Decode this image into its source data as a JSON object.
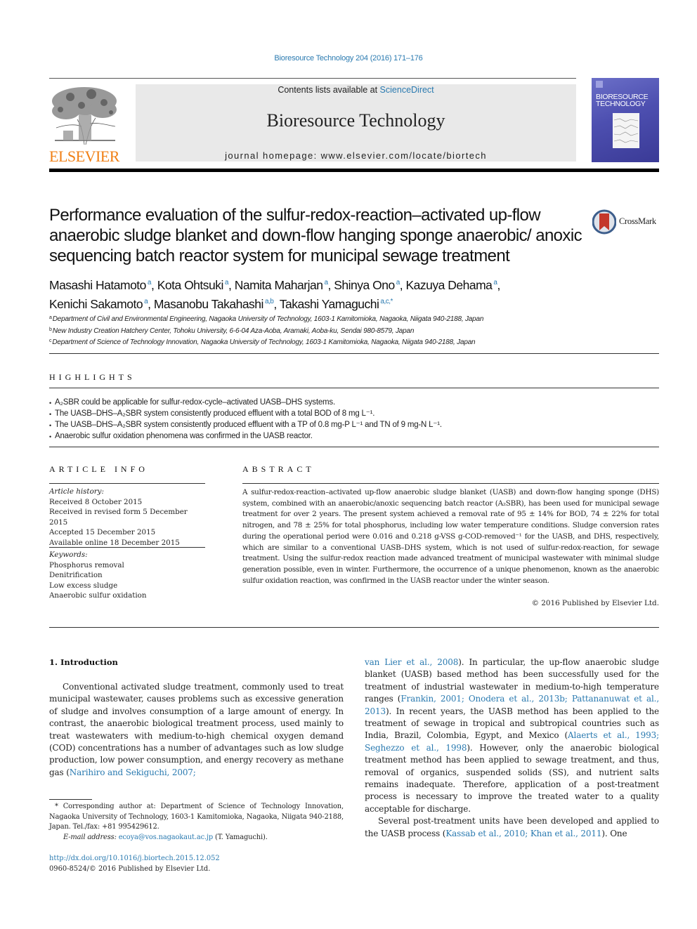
{
  "citation": "Bioresource Technology 204 (2016) 171–176",
  "header": {
    "publisher_logo_text": "ELSEVIER",
    "contents_prefix": "Contents lists available at ",
    "contents_link": "ScienceDirect",
    "journal_name": "Bioresource Technology",
    "homepage_label": "journal homepage: ",
    "homepage_url": "www.elsevier.com/locate/biortech",
    "cover_title_line1": "BIORESOURCE",
    "cover_title_line2": "TECHNOLOGY",
    "colors": {
      "link": "#2a7ab0",
      "elsevier_orange": "#f07f14",
      "band": "#e9e9e9"
    }
  },
  "article": {
    "title": "Performance evaluation of the sulfur-redox-reaction–activated up-flow anaerobic sludge blanket and down-flow hanging sponge anaerobic/ anoxic sequencing batch reactor system for municipal sewage treatment",
    "crossmark_label": "CrossMark",
    "authors": [
      {
        "name": "Masashi Hatamoto",
        "sup": "a",
        "sep": ", "
      },
      {
        "name": "Kota Ohtsuki",
        "sup": "a",
        "sep": ", "
      },
      {
        "name": "Namita Maharjan",
        "sup": "a",
        "sep": ", "
      },
      {
        "name": "Shinya Ono",
        "sup": "a",
        "sep": ", "
      },
      {
        "name": "Kazuya Dehama",
        "sup": "a",
        "sep": ","
      },
      {
        "name": "Kenichi Sakamoto",
        "sup": "a",
        "sep": ", "
      },
      {
        "name": "Masanobu Takahashi",
        "sup": "a,b",
        "sep": ", "
      },
      {
        "name": "Takashi Yamaguchi",
        "sup": "a,c,*",
        "sep": ""
      }
    ],
    "affiliations": [
      {
        "sup": "a",
        "text": "Department of Civil and Environmental Engineering, Nagaoka University of Technology, 1603-1 Kamitomioka, Nagaoka, Niigata 940-2188, Japan"
      },
      {
        "sup": "b",
        "text": "New Industry Creation Hatchery Center, Tohoku University, 6-6-04 Aza-Aoba, Aramaki, Aoba-ku, Sendai 980-8579, Japan"
      },
      {
        "sup": "c",
        "text": "Department of Science of Technology Innovation, Nagaoka University of Technology, 1603-1 Kamitomioka, Nagaoka, Niigata 940-2188, Japan"
      }
    ]
  },
  "highlights": {
    "heading": "HIGHLIGHTS",
    "items": [
      "A₂SBR could be applicable for sulfur-redox-cycle–activated UASB–DHS systems.",
      "The UASB–DHS–A₂SBR system consistently produced effluent with a total BOD of 8 mg L⁻¹.",
      "The UASB–DHS–A₂SBR system consistently produced effluent with a TP of 0.8 mg-P L⁻¹ and TN of 9 mg-N L⁻¹.",
      "Anaerobic sulfur oxidation phenomena was confirmed in the UASB reactor."
    ]
  },
  "article_info": {
    "heading": "ARTICLE INFO",
    "history_label": "Article history:",
    "history": [
      "Received 8 October 2015",
      "Received in revised form 5 December 2015",
      "Accepted 15 December 2015",
      "Available online 18 December 2015"
    ],
    "keywords_label": "Keywords:",
    "keywords": [
      "Phosphorus removal",
      "Denitrification",
      "Low excess sludge",
      "Anaerobic sulfur oxidation"
    ]
  },
  "abstract": {
    "heading": "ABSTRACT",
    "text": "A sulfur-redox-reaction–activated up-flow anaerobic sludge blanket (UASB) and down-flow hanging sponge (DHS) system, combined with an anaerobic/anoxic sequencing batch reactor (A₂SBR), has been used for municipal sewage treatment for over 2 years. The present system achieved a removal rate of 95 ± 14% for BOD, 74 ± 22% for total nitrogen, and 78 ± 25% for total phosphorus, including low water temperature conditions. Sludge conversion rates during the operational period were 0.016 and 0.218 g-VSS g-COD-removed⁻¹ for the UASB, and DHS, respectively, which are similar to a conventional UASB–DHS system, which is not used of sulfur-redox-reaction, for sewage treatment. Using the sulfur-redox reaction made advanced treatment of municipal wastewater with minimal sludge generation possible, even in winter. Furthermore, the occurrence of a unique phenomenon, known as the anaerobic sulfur oxidation reaction, was confirmed in the UASB reactor under the winter season.",
    "copyright": "© 2016 Published by Elsevier Ltd."
  },
  "introduction": {
    "heading": "1. Introduction",
    "left_text_1": "Conventional activated sludge treatment, commonly used to treat municipal wastewater, causes problems such as excessive generation of sludge and involves consumption of a large amount of energy. In contrast, the anaerobic biological treatment process, used mainly to treat wastewaters with medium-to-high chemical oxygen demand (COD) concentrations has a number of advantages such as low sludge production, low power consumption, and energy recovery as methane gas (",
    "ref_1": "Narihiro and Sekiguchi, 2007; van Lier et al., 2008",
    "ref_1a": "Narihiro and Sekiguchi, 2007;",
    "ref_1b": "van Lier et al., 2008",
    "right_text_1": "). In particular, the up-flow anaerobic sludge blanket (UASB) based method has been successfully used for the treatment of industrial wastewater in medium-to-high temperature ranges (",
    "ref_2": "Frankin, 2001; Onodera et al., 2013b; Pattananuwat et al., 2013",
    "right_text_2": "). In recent years, the UASB method has been applied to the treatment of sewage in tropical and subtropical countries such as India, Brazil, Colombia, Egypt, and Mexico (",
    "ref_3": "Alaerts et al., 1993; Seghezzo et al., 1998",
    "right_text_3": "). However, only the anaerobic biological treatment method has been applied to sewage treatment, and thus, removal of organics, suspended solids (SS), and nutrient salts remains inadequate. Therefore, application of a post-treatment process is necessary to improve the treated water to a quality acceptable for discharge.",
    "right_text_4": "Several post-treatment units have been developed and applied to the UASB process (",
    "ref_4": "Kassab et al., 2010; Khan et al., 2011",
    "right_text_5": "). One"
  },
  "footnotes": {
    "corresponding": "* Corresponding author at: Department of Science of Technology Innovation, Nagaoka University of Technology, 1603-1 Kamitomioka, Nagaoka, Niigata 940-2188, Japan. Tel./fax: +81 995429612.",
    "email_label": "E-mail address: ",
    "email": "ecoya@vos.nagaokaut.ac.jp",
    "email_suffix": " (T. Yamaguchi).",
    "doi": "http://dx.doi.org/10.1016/j.biortech.2015.12.052",
    "issn": "0960-8524/© 2016 Published by Elsevier Ltd."
  }
}
